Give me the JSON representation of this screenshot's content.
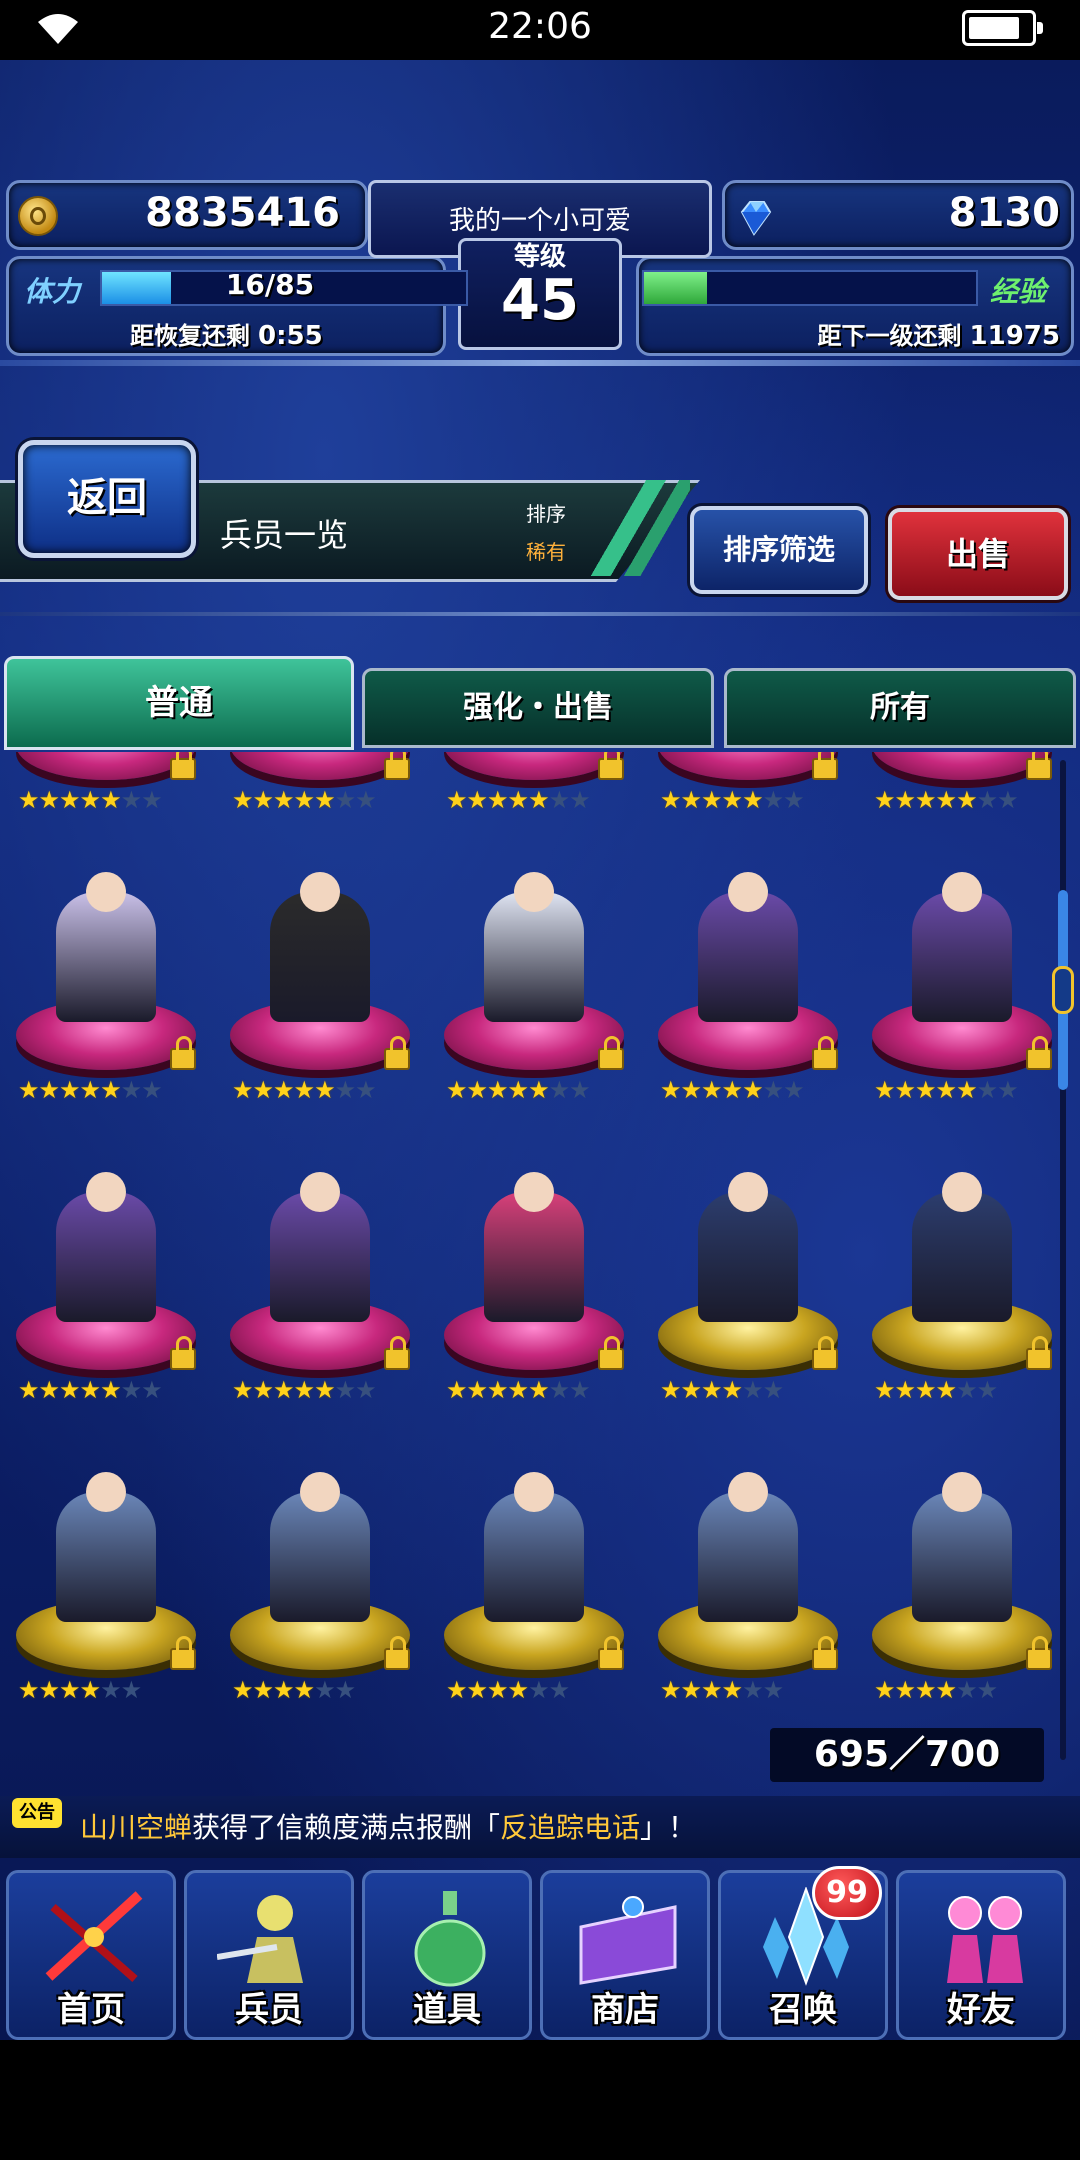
{
  "status_bar": {
    "time": "22:06"
  },
  "header": {
    "gold": "8835416",
    "gems": "8130",
    "player_name": "我的一个小可爱",
    "level_label": "等级",
    "level": "45",
    "stamina_label": "体力",
    "stamina": "16/85",
    "stamina_fraction": 0.19,
    "stamina_recover_label": "距恢复还剩",
    "stamina_recover_time": "0:55",
    "exp_label": "经验",
    "exp_fraction": 0.19,
    "exp_next_label": "距下一级还剩",
    "exp_next_value": "11975"
  },
  "toolbar": {
    "back_label": "返回",
    "title": "兵员一览",
    "sort_label": "排序",
    "sort_value": "稀有",
    "sort_filter_label": "排序筛选",
    "sell_label": "出售"
  },
  "tabs": [
    {
      "label": "普通",
      "active": true
    },
    {
      "label": "强化・出售",
      "active": false
    },
    {
      "label": "所有",
      "active": false
    }
  ],
  "units": {
    "rows": [
      [
        {
          "stars": 5,
          "max": 7,
          "pedestal": "pink",
          "locked": true
        },
        {
          "stars": 5,
          "max": 7,
          "pedestal": "pink",
          "locked": true
        },
        {
          "stars": 5,
          "max": 7,
          "pedestal": "pink",
          "locked": true
        },
        {
          "stars": 5,
          "max": 7,
          "pedestal": "pink",
          "locked": true
        },
        {
          "stars": 5,
          "max": 7,
          "pedestal": "pink",
          "locked": true
        }
      ],
      [
        {
          "stars": 5,
          "max": 7,
          "pedestal": "pink",
          "locked": true,
          "color": "#c9c0e8"
        },
        {
          "stars": 5,
          "max": 7,
          "pedestal": "pink",
          "locked": true,
          "color": "#2b2b2b"
        },
        {
          "stars": 5,
          "max": 7,
          "pedestal": "pink",
          "locked": true,
          "color": "#dfe4f2"
        },
        {
          "stars": 5,
          "max": 7,
          "pedestal": "pink",
          "locked": true,
          "color": "#6a4aa8"
        },
        {
          "stars": 5,
          "max": 7,
          "pedestal": "pink",
          "locked": true,
          "color": "#6a4aa8"
        }
      ],
      [
        {
          "stars": 5,
          "max": 7,
          "pedestal": "pink",
          "locked": true,
          "color": "#6a4aa8"
        },
        {
          "stars": 5,
          "max": 7,
          "pedestal": "pink",
          "locked": true,
          "color": "#6a4aa8"
        },
        {
          "stars": 5,
          "max": 7,
          "pedestal": "pink",
          "locked": true,
          "color": "#d8407a"
        },
        {
          "stars": 4,
          "max": 6,
          "pedestal": "gold",
          "locked": true,
          "color": "#2c3d6e"
        },
        {
          "stars": 4,
          "max": 6,
          "pedestal": "gold",
          "locked": true,
          "color": "#2c3d6e"
        }
      ],
      [
        {
          "stars": 4,
          "max": 6,
          "pedestal": "gold",
          "locked": true,
          "color": "#6a86b8"
        },
        {
          "stars": 4,
          "max": 6,
          "pedestal": "gold",
          "locked": true,
          "color": "#6a86b8"
        },
        {
          "stars": 4,
          "max": 6,
          "pedestal": "gold",
          "locked": true,
          "color": "#6a86b8"
        },
        {
          "stars": 4,
          "max": 6,
          "pedestal": "gold",
          "locked": true,
          "color": "#6a86b8"
        },
        {
          "stars": 4,
          "max": 6,
          "pedestal": "gold",
          "locked": true,
          "color": "#6a86b8"
        }
      ]
    ]
  },
  "unit_count": "695／700",
  "notice": {
    "badge": "公告",
    "player": "山川空蝉",
    "text_mid": "获得了信赖度满点报酬「",
    "reward": "反追踪电话",
    "text_end": "」！"
  },
  "nav": {
    "items": [
      {
        "label": "首页",
        "icon": "home-sword-icon"
      },
      {
        "label": "兵员",
        "icon": "unit-icon"
      },
      {
        "label": "道具",
        "icon": "potion-icon"
      },
      {
        "label": "商店",
        "icon": "shop-icon"
      },
      {
        "label": "召唤",
        "icon": "summon-crystal-icon"
      },
      {
        "label": "好友",
        "icon": "friends-icon"
      }
    ],
    "summon_badge": "99"
  }
}
